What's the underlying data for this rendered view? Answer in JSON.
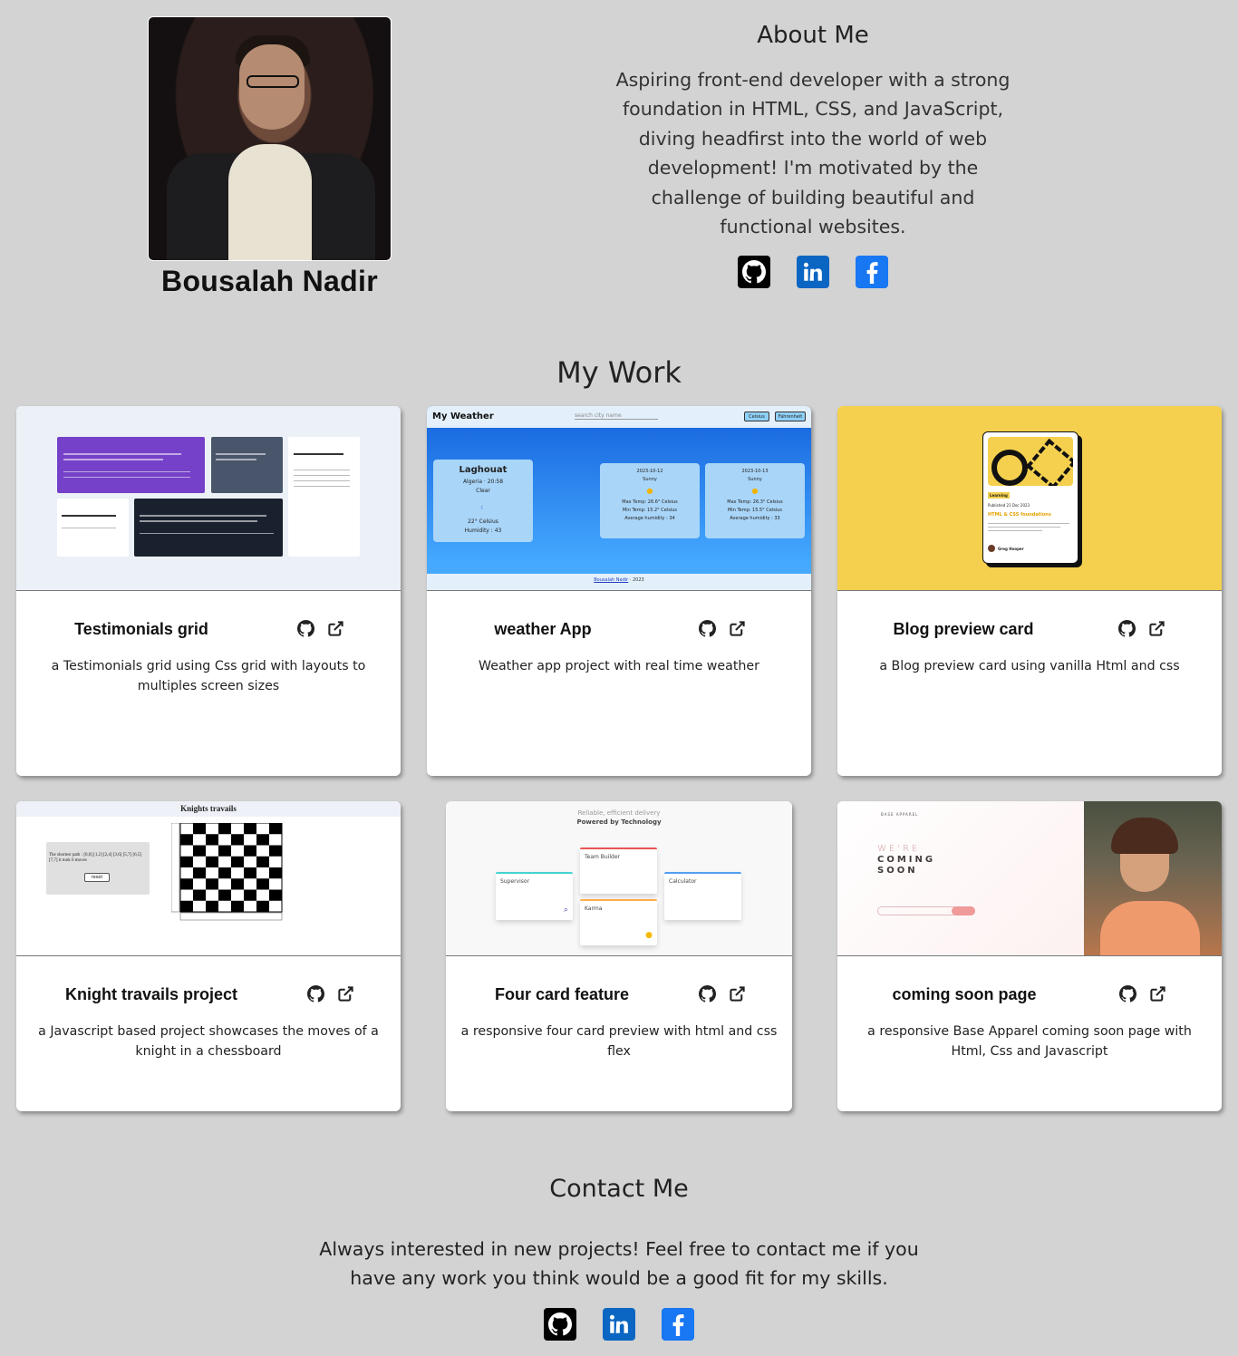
{
  "profile": {
    "name": "Bousalah Nadir"
  },
  "about": {
    "title": "About Me",
    "text": "Aspiring front-end developer with a strong foundation in HTML, CSS, and JavaScript, diving headfirst into the world of web development! I'm motivated by the challenge of building beautiful and functional websites."
  },
  "socials": [
    "github-icon",
    "linkedin-icon",
    "facebook-icon"
  ],
  "work": {
    "title": "My Work",
    "projects": [
      {
        "title": "Testimonials grid",
        "desc": "a Testimonials grid using Css grid with layouts to multiples screen sizes"
      },
      {
        "title": "weather App",
        "desc": "Weather app project with real time weather"
      },
      {
        "title": "Blog preview card",
        "desc": "a Blog preview card using vanilla Html and css"
      },
      {
        "title": "Knight travails project",
        "desc": "a Javascript based project showcases the moves of a knight in a chessboard"
      },
      {
        "title": "Four card feature",
        "desc": "a responsive four card preview with html and css flex"
      },
      {
        "title": "coming soon page",
        "desc": "a responsive Base Apparel coming soon page with Html, Css and Javascript"
      }
    ]
  },
  "thumbs": {
    "weather": {
      "app": "My Weather",
      "search": "search city name",
      "celsius": "Celsius",
      "fahrenheit": "Fahrenheit",
      "city": "Laghouat",
      "region": "Algeria · 20:58",
      "cond": "Clear",
      "temp": "22° Celsius",
      "hum": "Humidity : 43",
      "day1": {
        "date": "2023-10-12",
        "cond": "Sunny",
        "max": "Max Temp: 26.6° Celsius",
        "min": "Min Temp: 15.2° Celsius",
        "hum": "Average humidity : 34"
      },
      "day2": {
        "date": "2023-10-13",
        "cond": "Sunny",
        "max": "Max Temp: 26.3° Celsius",
        "min": "Min Temp: 15.5° Celsius",
        "hum": "Average humidity : 33"
      },
      "footer_link": "Bousalah Nadir",
      "footer_year": "2023"
    },
    "blog": {
      "tag": "Learning",
      "date": "Published 21 Dec 2023",
      "title": "HTML & CSS foundations",
      "author": "Greg Hooper"
    },
    "knight": {
      "title": "Knights travails",
      "path": "The shortest path : [0,0] [1,2] [2,4] [3,6] [5,7] [6,5] [7,7] it took 6 moves",
      "reset": "reset"
    },
    "feature": {
      "line1": "Reliable, efficient delivery",
      "line2": "Powered by Technology",
      "c1": "Supervisor",
      "c2": "Team Builder",
      "c3": "Karma",
      "c4": "Calculator"
    },
    "soon": {
      "brand": "BASE APPAREL",
      "line1": "WE'RE",
      "line2": "COMING",
      "line3": "SOON"
    }
  },
  "contact": {
    "title": "Contact Me",
    "text": "Always interested in new projects! Feel free to contact me if you have any work you think would be a good fit for my skills."
  }
}
